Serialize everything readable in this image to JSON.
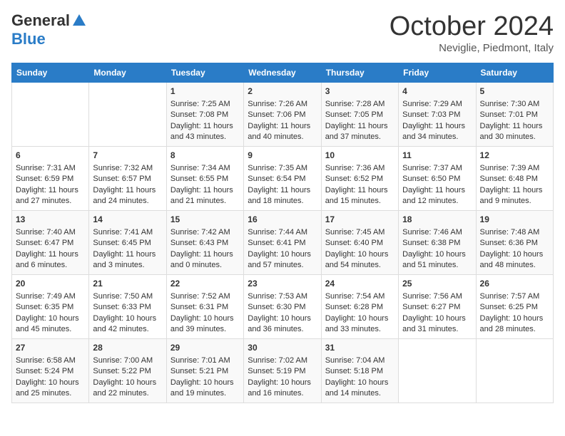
{
  "header": {
    "logo_general": "General",
    "logo_blue": "Blue",
    "month": "October 2024",
    "location": "Neviglie, Piedmont, Italy"
  },
  "weekdays": [
    "Sunday",
    "Monday",
    "Tuesday",
    "Wednesday",
    "Thursday",
    "Friday",
    "Saturday"
  ],
  "weeks": [
    [
      {
        "day": "",
        "sunrise": "",
        "sunset": "",
        "daylight": ""
      },
      {
        "day": "",
        "sunrise": "",
        "sunset": "",
        "daylight": ""
      },
      {
        "day": "1",
        "sunrise": "Sunrise: 7:25 AM",
        "sunset": "Sunset: 7:08 PM",
        "daylight": "Daylight: 11 hours and 43 minutes."
      },
      {
        "day": "2",
        "sunrise": "Sunrise: 7:26 AM",
        "sunset": "Sunset: 7:06 PM",
        "daylight": "Daylight: 11 hours and 40 minutes."
      },
      {
        "day": "3",
        "sunrise": "Sunrise: 7:28 AM",
        "sunset": "Sunset: 7:05 PM",
        "daylight": "Daylight: 11 hours and 37 minutes."
      },
      {
        "day": "4",
        "sunrise": "Sunrise: 7:29 AM",
        "sunset": "Sunset: 7:03 PM",
        "daylight": "Daylight: 11 hours and 34 minutes."
      },
      {
        "day": "5",
        "sunrise": "Sunrise: 7:30 AM",
        "sunset": "Sunset: 7:01 PM",
        "daylight": "Daylight: 11 hours and 30 minutes."
      }
    ],
    [
      {
        "day": "6",
        "sunrise": "Sunrise: 7:31 AM",
        "sunset": "Sunset: 6:59 PM",
        "daylight": "Daylight: 11 hours and 27 minutes."
      },
      {
        "day": "7",
        "sunrise": "Sunrise: 7:32 AM",
        "sunset": "Sunset: 6:57 PM",
        "daylight": "Daylight: 11 hours and 24 minutes."
      },
      {
        "day": "8",
        "sunrise": "Sunrise: 7:34 AM",
        "sunset": "Sunset: 6:55 PM",
        "daylight": "Daylight: 11 hours and 21 minutes."
      },
      {
        "day": "9",
        "sunrise": "Sunrise: 7:35 AM",
        "sunset": "Sunset: 6:54 PM",
        "daylight": "Daylight: 11 hours and 18 minutes."
      },
      {
        "day": "10",
        "sunrise": "Sunrise: 7:36 AM",
        "sunset": "Sunset: 6:52 PM",
        "daylight": "Daylight: 11 hours and 15 minutes."
      },
      {
        "day": "11",
        "sunrise": "Sunrise: 7:37 AM",
        "sunset": "Sunset: 6:50 PM",
        "daylight": "Daylight: 11 hours and 12 minutes."
      },
      {
        "day": "12",
        "sunrise": "Sunrise: 7:39 AM",
        "sunset": "Sunset: 6:48 PM",
        "daylight": "Daylight: 11 hours and 9 minutes."
      }
    ],
    [
      {
        "day": "13",
        "sunrise": "Sunrise: 7:40 AM",
        "sunset": "Sunset: 6:47 PM",
        "daylight": "Daylight: 11 hours and 6 minutes."
      },
      {
        "day": "14",
        "sunrise": "Sunrise: 7:41 AM",
        "sunset": "Sunset: 6:45 PM",
        "daylight": "Daylight: 11 hours and 3 minutes."
      },
      {
        "day": "15",
        "sunrise": "Sunrise: 7:42 AM",
        "sunset": "Sunset: 6:43 PM",
        "daylight": "Daylight: 11 hours and 0 minutes."
      },
      {
        "day": "16",
        "sunrise": "Sunrise: 7:44 AM",
        "sunset": "Sunset: 6:41 PM",
        "daylight": "Daylight: 10 hours and 57 minutes."
      },
      {
        "day": "17",
        "sunrise": "Sunrise: 7:45 AM",
        "sunset": "Sunset: 6:40 PM",
        "daylight": "Daylight: 10 hours and 54 minutes."
      },
      {
        "day": "18",
        "sunrise": "Sunrise: 7:46 AM",
        "sunset": "Sunset: 6:38 PM",
        "daylight": "Daylight: 10 hours and 51 minutes."
      },
      {
        "day": "19",
        "sunrise": "Sunrise: 7:48 AM",
        "sunset": "Sunset: 6:36 PM",
        "daylight": "Daylight: 10 hours and 48 minutes."
      }
    ],
    [
      {
        "day": "20",
        "sunrise": "Sunrise: 7:49 AM",
        "sunset": "Sunset: 6:35 PM",
        "daylight": "Daylight: 10 hours and 45 minutes."
      },
      {
        "day": "21",
        "sunrise": "Sunrise: 7:50 AM",
        "sunset": "Sunset: 6:33 PM",
        "daylight": "Daylight: 10 hours and 42 minutes."
      },
      {
        "day": "22",
        "sunrise": "Sunrise: 7:52 AM",
        "sunset": "Sunset: 6:31 PM",
        "daylight": "Daylight: 10 hours and 39 minutes."
      },
      {
        "day": "23",
        "sunrise": "Sunrise: 7:53 AM",
        "sunset": "Sunset: 6:30 PM",
        "daylight": "Daylight: 10 hours and 36 minutes."
      },
      {
        "day": "24",
        "sunrise": "Sunrise: 7:54 AM",
        "sunset": "Sunset: 6:28 PM",
        "daylight": "Daylight: 10 hours and 33 minutes."
      },
      {
        "day": "25",
        "sunrise": "Sunrise: 7:56 AM",
        "sunset": "Sunset: 6:27 PM",
        "daylight": "Daylight: 10 hours and 31 minutes."
      },
      {
        "day": "26",
        "sunrise": "Sunrise: 7:57 AM",
        "sunset": "Sunset: 6:25 PM",
        "daylight": "Daylight: 10 hours and 28 minutes."
      }
    ],
    [
      {
        "day": "27",
        "sunrise": "Sunrise: 6:58 AM",
        "sunset": "Sunset: 5:24 PM",
        "daylight": "Daylight: 10 hours and 25 minutes."
      },
      {
        "day": "28",
        "sunrise": "Sunrise: 7:00 AM",
        "sunset": "Sunset: 5:22 PM",
        "daylight": "Daylight: 10 hours and 22 minutes."
      },
      {
        "day": "29",
        "sunrise": "Sunrise: 7:01 AM",
        "sunset": "Sunset: 5:21 PM",
        "daylight": "Daylight: 10 hours and 19 minutes."
      },
      {
        "day": "30",
        "sunrise": "Sunrise: 7:02 AM",
        "sunset": "Sunset: 5:19 PM",
        "daylight": "Daylight: 10 hours and 16 minutes."
      },
      {
        "day": "31",
        "sunrise": "Sunrise: 7:04 AM",
        "sunset": "Sunset: 5:18 PM",
        "daylight": "Daylight: 10 hours and 14 minutes."
      },
      {
        "day": "",
        "sunrise": "",
        "sunset": "",
        "daylight": ""
      },
      {
        "day": "",
        "sunrise": "",
        "sunset": "",
        "daylight": ""
      }
    ]
  ]
}
